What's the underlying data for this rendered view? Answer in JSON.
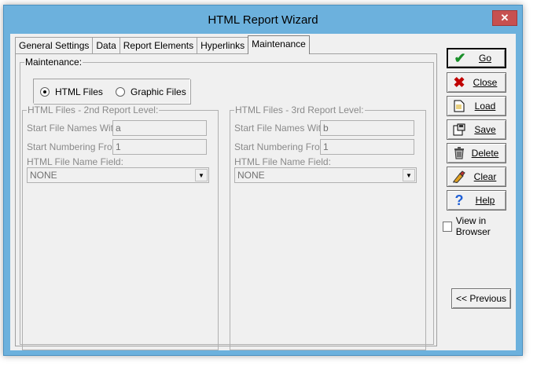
{
  "window": {
    "title": "HTML Report Wizard",
    "close_glyph": "✕"
  },
  "tabs": [
    {
      "label": "General Settings"
    },
    {
      "label": "Data"
    },
    {
      "label": "Report Elements"
    },
    {
      "label": "Hyperlinks"
    },
    {
      "label": "Maintenance"
    }
  ],
  "maintenance": {
    "legend": "Maintenance:",
    "radio_html": "HTML Files",
    "radio_graphic": "Graphic Files",
    "selected": "HTML Files"
  },
  "level2": {
    "legend": "HTML Files - 2nd Report Level:",
    "start_names_label": "Start File Names With:",
    "start_names_value": "a",
    "start_numbering_label": "Start Numbering From:",
    "start_numbering_value": "1",
    "name_field_label": "HTML File Name Field:",
    "name_field_value": "NONE"
  },
  "level3": {
    "legend": "HTML Files - 3rd Report Level:",
    "start_names_label": "Start File Names With:",
    "start_names_value": "b",
    "start_numbering_label": "Start Numbering From:",
    "start_numbering_value": "1",
    "name_field_label": "HTML File Name Field:",
    "name_field_value": "NONE"
  },
  "buttons": {
    "go": "Go",
    "close": "Close",
    "load": "Load",
    "save": "Save",
    "delete": "Delete",
    "clear": "Clear",
    "help": "Help",
    "previous": "<< Previous"
  },
  "view_in_browser": {
    "label": "View in Browser",
    "checked": false
  },
  "icons": {
    "go": "checkmark-icon",
    "close": "red-x-icon",
    "load": "document-icon",
    "save": "save-icon",
    "delete": "trash-icon",
    "clear": "eraser-icon",
    "help": "question-icon"
  },
  "colors": {
    "title_bar": "#6cb1dd",
    "close_button": "#c75050",
    "go_check": "#1a8f2a",
    "close_x": "#c00000",
    "help_question": "#1f5fd6"
  }
}
